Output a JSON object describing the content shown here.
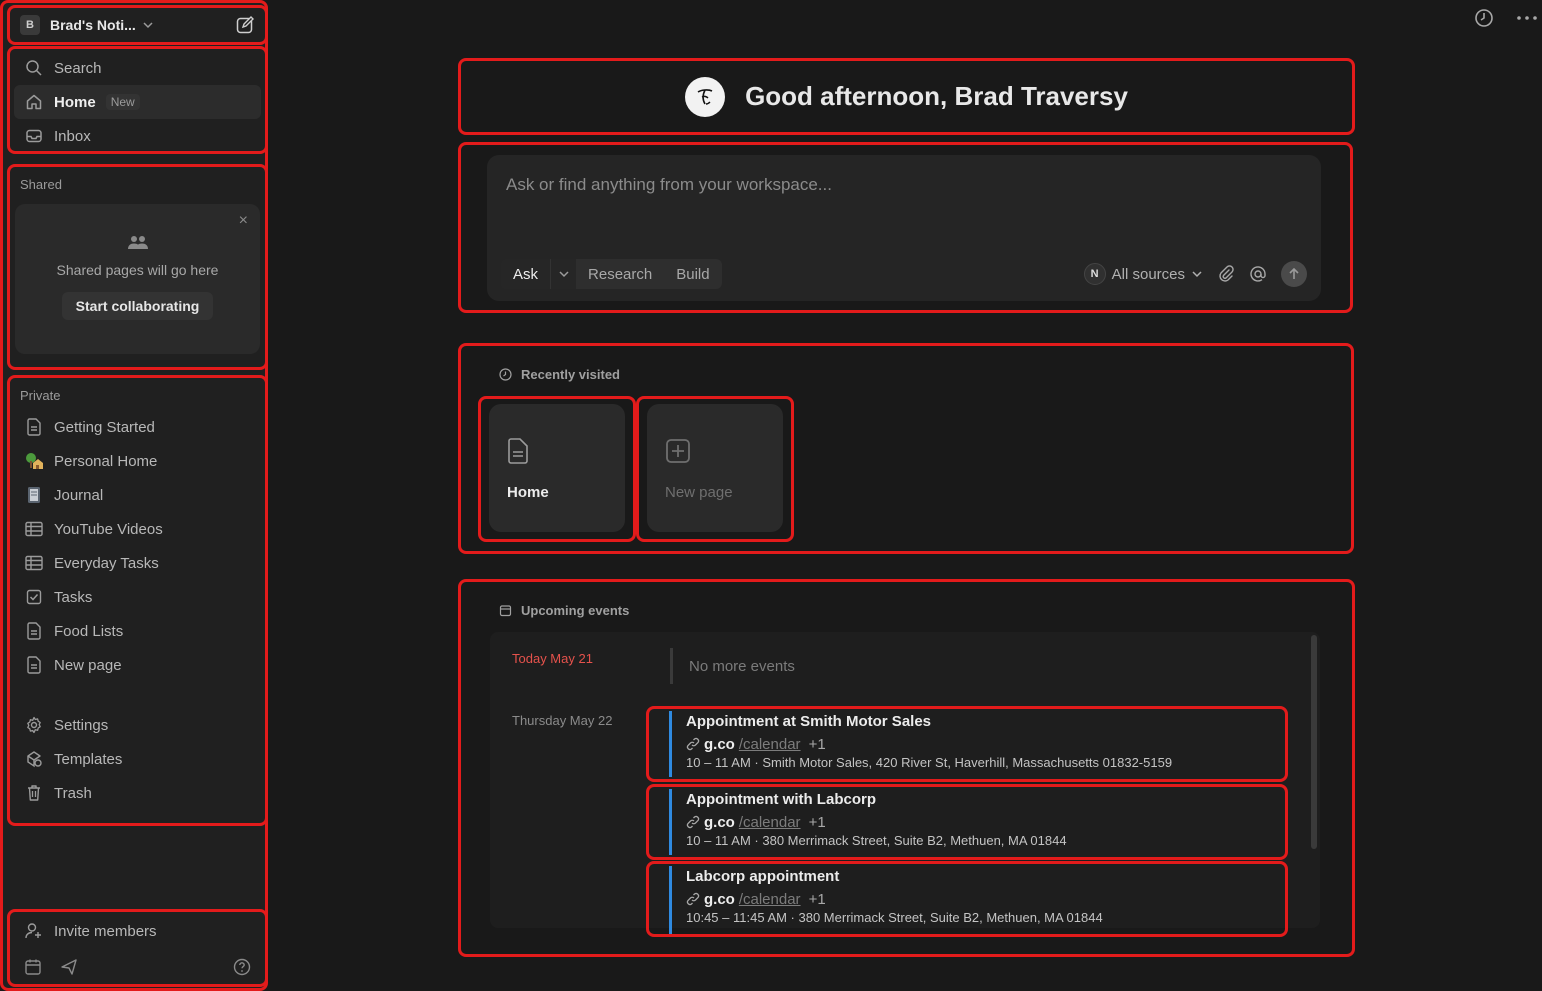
{
  "workspace": {
    "avatar": "B",
    "name": "Brad's Noti..."
  },
  "nav_top": [
    {
      "label": "Search",
      "icon": "search-icon"
    },
    {
      "label": "Home",
      "icon": "home-icon",
      "badge": "New",
      "active": true
    },
    {
      "label": "Inbox",
      "icon": "inbox-icon"
    }
  ],
  "shared": {
    "label": "Shared",
    "empty_text": "Shared pages will go here",
    "cta": "Start collaborating",
    "close": "×"
  },
  "private": {
    "label": "Private",
    "pages": [
      {
        "label": "Getting Started",
        "icon": "page-icon"
      },
      {
        "label": "Personal Home",
        "icon": "house-tree-emoji-icon"
      },
      {
        "label": "Journal",
        "icon": "notebook-emoji-icon"
      },
      {
        "label": "YouTube Videos",
        "icon": "table-icon"
      },
      {
        "label": "Everyday Tasks",
        "icon": "table-icon"
      },
      {
        "label": "Tasks",
        "icon": "checkbox-icon"
      },
      {
        "label": "Food Lists",
        "icon": "page-icon"
      },
      {
        "label": "New page",
        "icon": "page-icon"
      }
    ],
    "utilities": [
      {
        "label": "Settings",
        "icon": "gear-icon"
      },
      {
        "label": "Templates",
        "icon": "templates-icon"
      },
      {
        "label": "Trash",
        "icon": "trash-icon"
      }
    ]
  },
  "footer": {
    "invite_label": "Invite members"
  },
  "greeting": "Good afternoon, Brad Traversy",
  "ask": {
    "placeholder": "Ask or find anything from your workspace...",
    "modes": [
      "Ask",
      "Research",
      "Build"
    ],
    "sources_label": "All sources",
    "sources_badge": "N"
  },
  "recent": {
    "heading": "Recently visited",
    "tiles": [
      {
        "label": "Home",
        "icon": "page-icon"
      },
      {
        "label": "New page",
        "icon": "plus-square-icon"
      }
    ]
  },
  "events": {
    "heading": "Upcoming events",
    "today_label": "Today May 21",
    "no_events": "No more events",
    "next_day_label": "Thursday May 22",
    "items": [
      {
        "title": "Appointment at Smith Motor Sales",
        "link_domain": "g.co",
        "link_path": "/calendar",
        "link_extra": "+1",
        "meta": "10 – 11 AM · Smith Motor Sales, 420 River St, Haverhill, Massachusetts 01832-5159"
      },
      {
        "title": "Appointment with Labcorp",
        "link_domain": "g.co",
        "link_path": "/calendar",
        "link_extra": "+1",
        "meta": "10 – 11 AM · 380 Merrimack Street, Suite B2, Methuen, MA 01844"
      },
      {
        "title": "Labcorp appointment",
        "link_domain": "g.co",
        "link_path": "/calendar",
        "link_extra": "+1",
        "meta": "10:45 – 11:45 AM · 380 Merrimack Street, Suite B2, Methuen, MA 01844"
      }
    ]
  },
  "colors": {
    "background": "#191919",
    "sidebar": "#202020",
    "annotation": "#e31b1b",
    "event_bar": "#2f8ae0",
    "today": "#e5524c"
  }
}
